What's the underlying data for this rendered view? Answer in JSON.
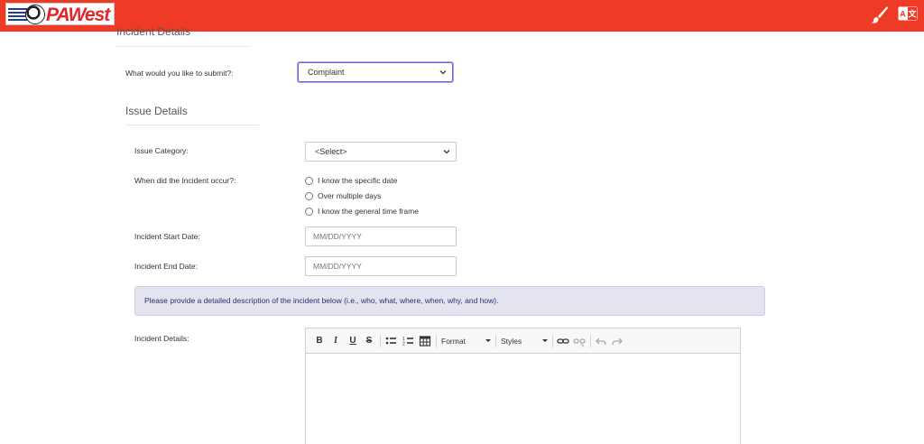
{
  "header": {
    "logo_text": "PAWest",
    "brush_icon": "paintbrush-icon",
    "language_icon": "language-translate-icon",
    "bar_color": "#ef3a25"
  },
  "incident_section": {
    "title": "Incident Details",
    "submit_label": "What would you like to submit?:",
    "submit_value": "Complaint"
  },
  "issue_section": {
    "title": "Issue Details",
    "category_label": "Issue Category:",
    "category_value": "<Select>",
    "occur_label": "When did the Incident occur?:",
    "occur_options": [
      "I know the specific date",
      "Over multiple days",
      "I know the general time frame"
    ],
    "start_label": "Incident Start Date:",
    "start_placeholder": "MM/DD/YYYY",
    "end_label": "Incident End Date:",
    "end_placeholder": "MM/DD/YYYY",
    "info_text": "Please provide a detailed description of the incident below (i.e., who, what, where, when, why, and how).",
    "details_label": "Incident Details:"
  },
  "editor": {
    "bold": "B",
    "italic": "I",
    "underline": "U",
    "strike": "S",
    "format_label": "Format",
    "styles_label": "Styles",
    "icons": [
      "bold-icon",
      "italic-icon",
      "underline-icon",
      "strikethrough-icon",
      "bulleted-list-icon",
      "numbered-list-icon",
      "table-icon",
      "link-icon",
      "unlink-icon",
      "undo-icon",
      "redo-icon"
    ]
  }
}
